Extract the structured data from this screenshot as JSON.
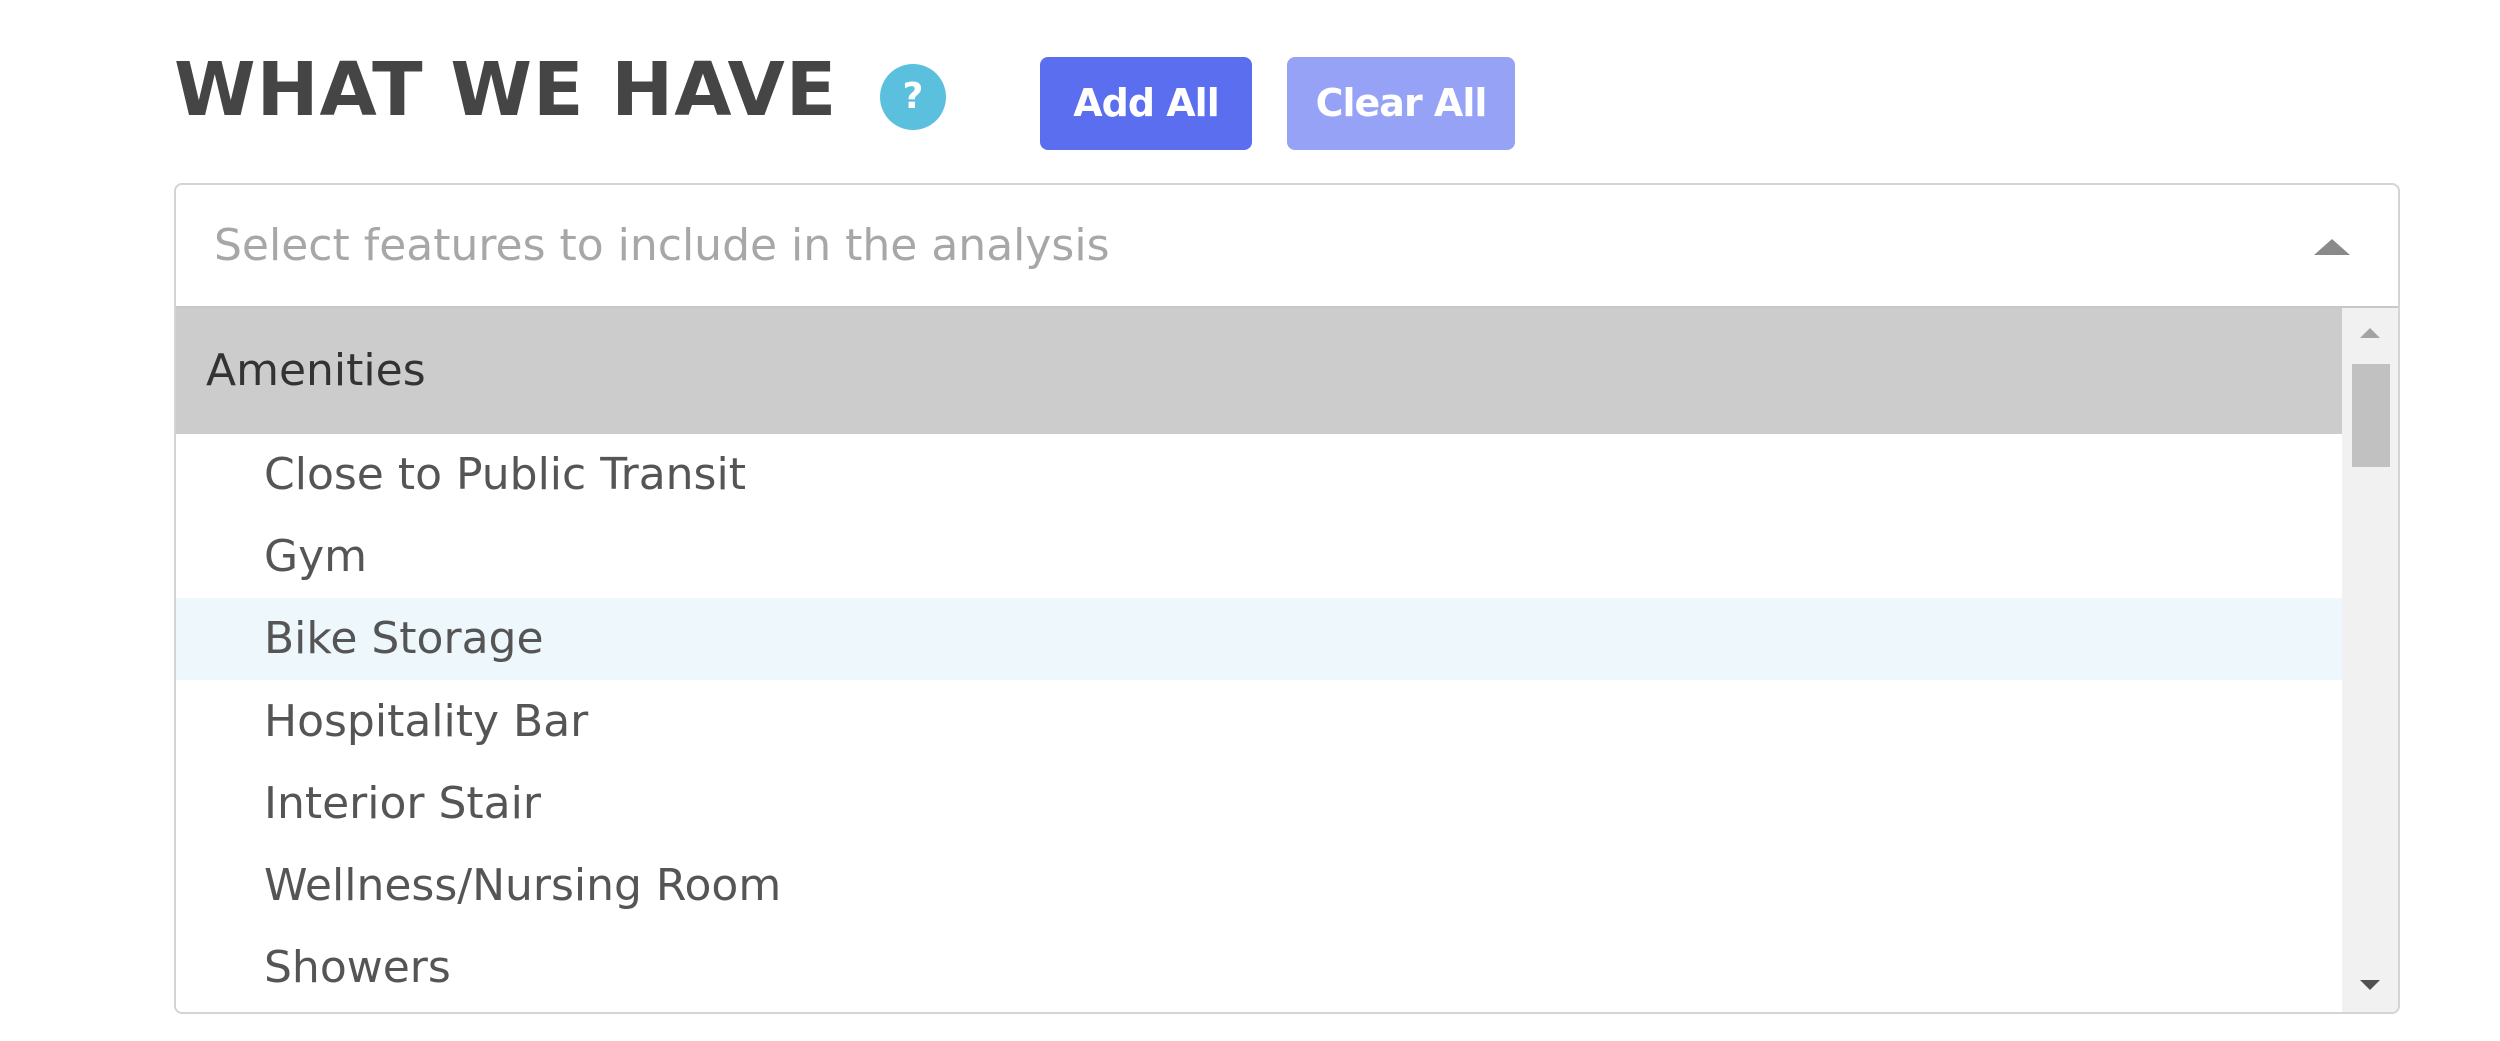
{
  "header": {
    "title": "WHAT WE HAVE",
    "help_icon": "question-mark-circle-icon",
    "help_symbol": "?",
    "add_all_label": "Add All",
    "clear_all_label": "Clear All"
  },
  "select": {
    "placeholder": "Select features to include in the analysis",
    "value": "",
    "expanded": true,
    "caret_icon": "caret-up-icon"
  },
  "dropdown": {
    "group_label": "Amenities",
    "options": [
      {
        "label": "Close to Public Transit"
      },
      {
        "label": "Gym"
      },
      {
        "label": "Bike Storage"
      },
      {
        "label": "Hospitality Bar"
      },
      {
        "label": "Interior Stair"
      },
      {
        "label": "Wellness/Nursing Room"
      },
      {
        "label": "Showers"
      }
    ],
    "highlighted_option": "Bike Storage"
  },
  "colors": {
    "title_text": "#454545",
    "help_icon_bg": "#5bc0de",
    "add_all_bg": "#5b6ef0",
    "clear_all_bg": "#96a2f5",
    "group_header_bg": "#cccccc",
    "highlight_bg": "#eef7fb",
    "placeholder_text": "#a7a7a7",
    "option_text": "#555555"
  }
}
